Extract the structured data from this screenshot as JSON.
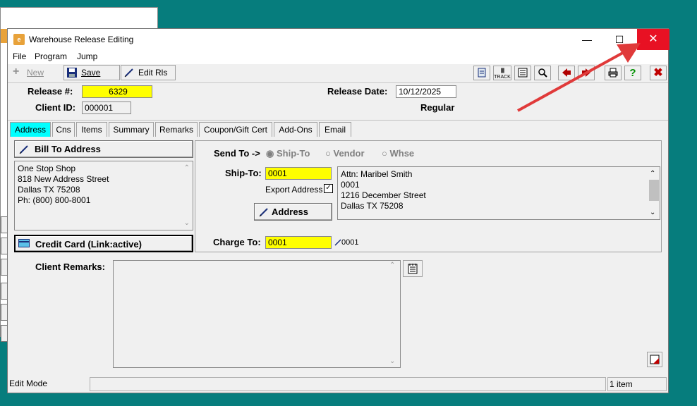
{
  "window": {
    "title": "Warehouse Release Editing",
    "controls": {
      "minimize": "—",
      "maximize": "☐",
      "close": "✕"
    }
  },
  "menu": [
    "File",
    "Program",
    "Jump"
  ],
  "toolbar": {
    "new_label": "New",
    "save_label": "Save",
    "edit_rls_label": "Edit Rls",
    "track_label": "TRACK",
    "right_icons": [
      "notes-icon",
      "barcode-track-icon",
      "document-icon",
      "magnifier-icon",
      "arrow-left-icon",
      "arrow-right-icon",
      "print-icon",
      "help-icon",
      "exit-icon"
    ]
  },
  "header": {
    "release_label": "Release #:",
    "release_value": "6329",
    "client_label": "Client ID:",
    "client_value": "000001",
    "release_date_label": "Release Date:",
    "release_date_value": "10/12/2025",
    "type_value": "Regular"
  },
  "tabs": [
    "Address",
    "Cns",
    "Items",
    "Summary",
    "Remarks",
    "Coupon/Gift Cert",
    "Add-Ons",
    "Email"
  ],
  "bill_to": {
    "button_label": "Bill To Address",
    "lines": [
      "One Stop Shop",
      "818 New Address Street",
      "Dallas  TX   75208",
      "Ph: (800) 800-8001"
    ],
    "credit_card_label": "Credit Card (Link:active)"
  },
  "send_to": {
    "label": "Send To ->",
    "options": [
      "Ship-To",
      "Vendor",
      "Whse"
    ],
    "selected": "Ship-To",
    "ship_to_label": "Ship-To:",
    "ship_to_value": "0001",
    "export_address_label": "Export Address",
    "export_checkmark": "✓",
    "address_button_label": "Address",
    "address_lines": [
      "Attn: Maribel Smith",
      "0001",
      "1216 December Street",
      "Dallas  TX    75208"
    ],
    "charge_to_label": "Charge To:",
    "charge_to_value": "0001",
    "charge_to_display": "0001"
  },
  "remarks": {
    "label": "Client Remarks:",
    "value": ""
  },
  "status": {
    "mode": "Edit Mode",
    "middle": "",
    "count": "1 item"
  },
  "colors": {
    "accent": "#00ffff",
    "highlight": "#ffff00",
    "close": "#e81123",
    "desktop": "#067d7d"
  }
}
